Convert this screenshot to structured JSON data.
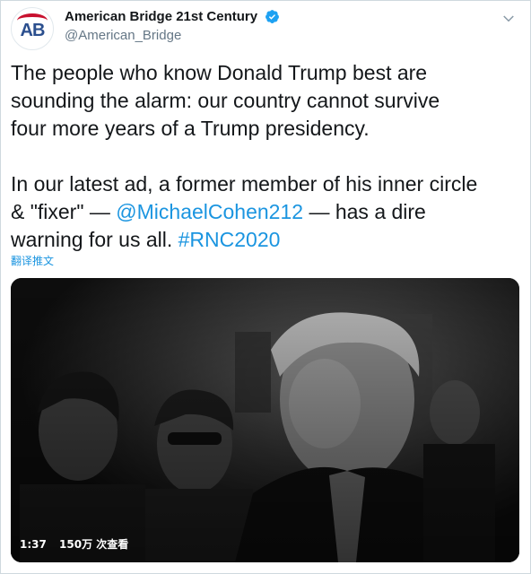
{
  "account": {
    "display_name": "American Bridge 21st Century",
    "handle": "@American_Bridge",
    "avatar_text": "AB",
    "verified": true
  },
  "tweet": {
    "para1": "The people who know Donald Trump best are\nsounding the alarm: our country cannot survive\nfour more years of a Trump presidency.",
    "para2_a": "In our latest ad, a former member of his inner circle\n& \"fixer\" — ",
    "mention": "@MichaelCohen212",
    "para2_b": " — has a dire\nwarning for us all. ",
    "hashtag": "#RNC2020",
    "translate_label": "翻译推文"
  },
  "video": {
    "duration": "1:37",
    "views": "150万 次查看"
  },
  "colors": {
    "link": "#1b95e0",
    "verified": "#1da1f2",
    "brand_red": "#c8102e",
    "brand_blue": "#2b4f8e"
  },
  "icons": [
    "verified-badge-icon",
    "chevron-down-icon"
  ]
}
